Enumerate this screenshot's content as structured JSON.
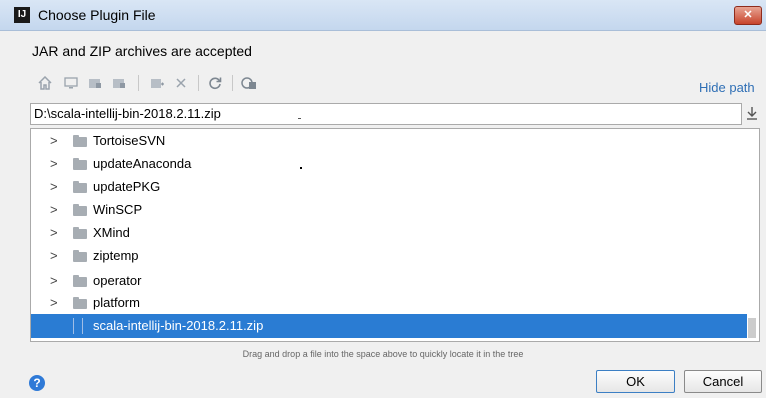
{
  "window": {
    "title": "Choose Plugin File",
    "app_icon": "IJ",
    "close_glyph": "✕"
  },
  "description": "JAR and ZIP archives are accepted",
  "toolbar": {
    "icons": [
      "home-icon",
      "desktop-icon",
      "project-icon",
      "module-icon",
      "new-folder-icon",
      "delete-icon",
      "refresh-icon",
      "show-hidden-icon"
    ],
    "hide_path": "Hide path"
  },
  "path": {
    "value": "D:\\scala-intellij-bin-2018.2.11.zip"
  },
  "tree": {
    "items": [
      {
        "label": "TortoiseSVN",
        "type": "folder"
      },
      {
        "label": "updateAnaconda",
        "type": "folder"
      },
      {
        "label": "updatePKG",
        "type": "folder"
      },
      {
        "label": "WinSCP",
        "type": "folder"
      },
      {
        "label": "XMind",
        "type": "folder"
      },
      {
        "label": "ziptemp",
        "type": "folder"
      },
      {
        "label": "operator",
        "type": "folder"
      },
      {
        "label": "platform",
        "type": "folder"
      },
      {
        "label": "scala-intellij-bin-2018.2.11.zip",
        "type": "file",
        "selected": true
      }
    ]
  },
  "hint": "Drag and drop a file into the space above to quickly locate it in the tree",
  "buttons": {
    "help": "?",
    "ok": "OK",
    "cancel": "Cancel"
  },
  "colors": {
    "selection": "#2a7cd3",
    "link": "#2f6fb5",
    "help": "#2f7ad7"
  }
}
